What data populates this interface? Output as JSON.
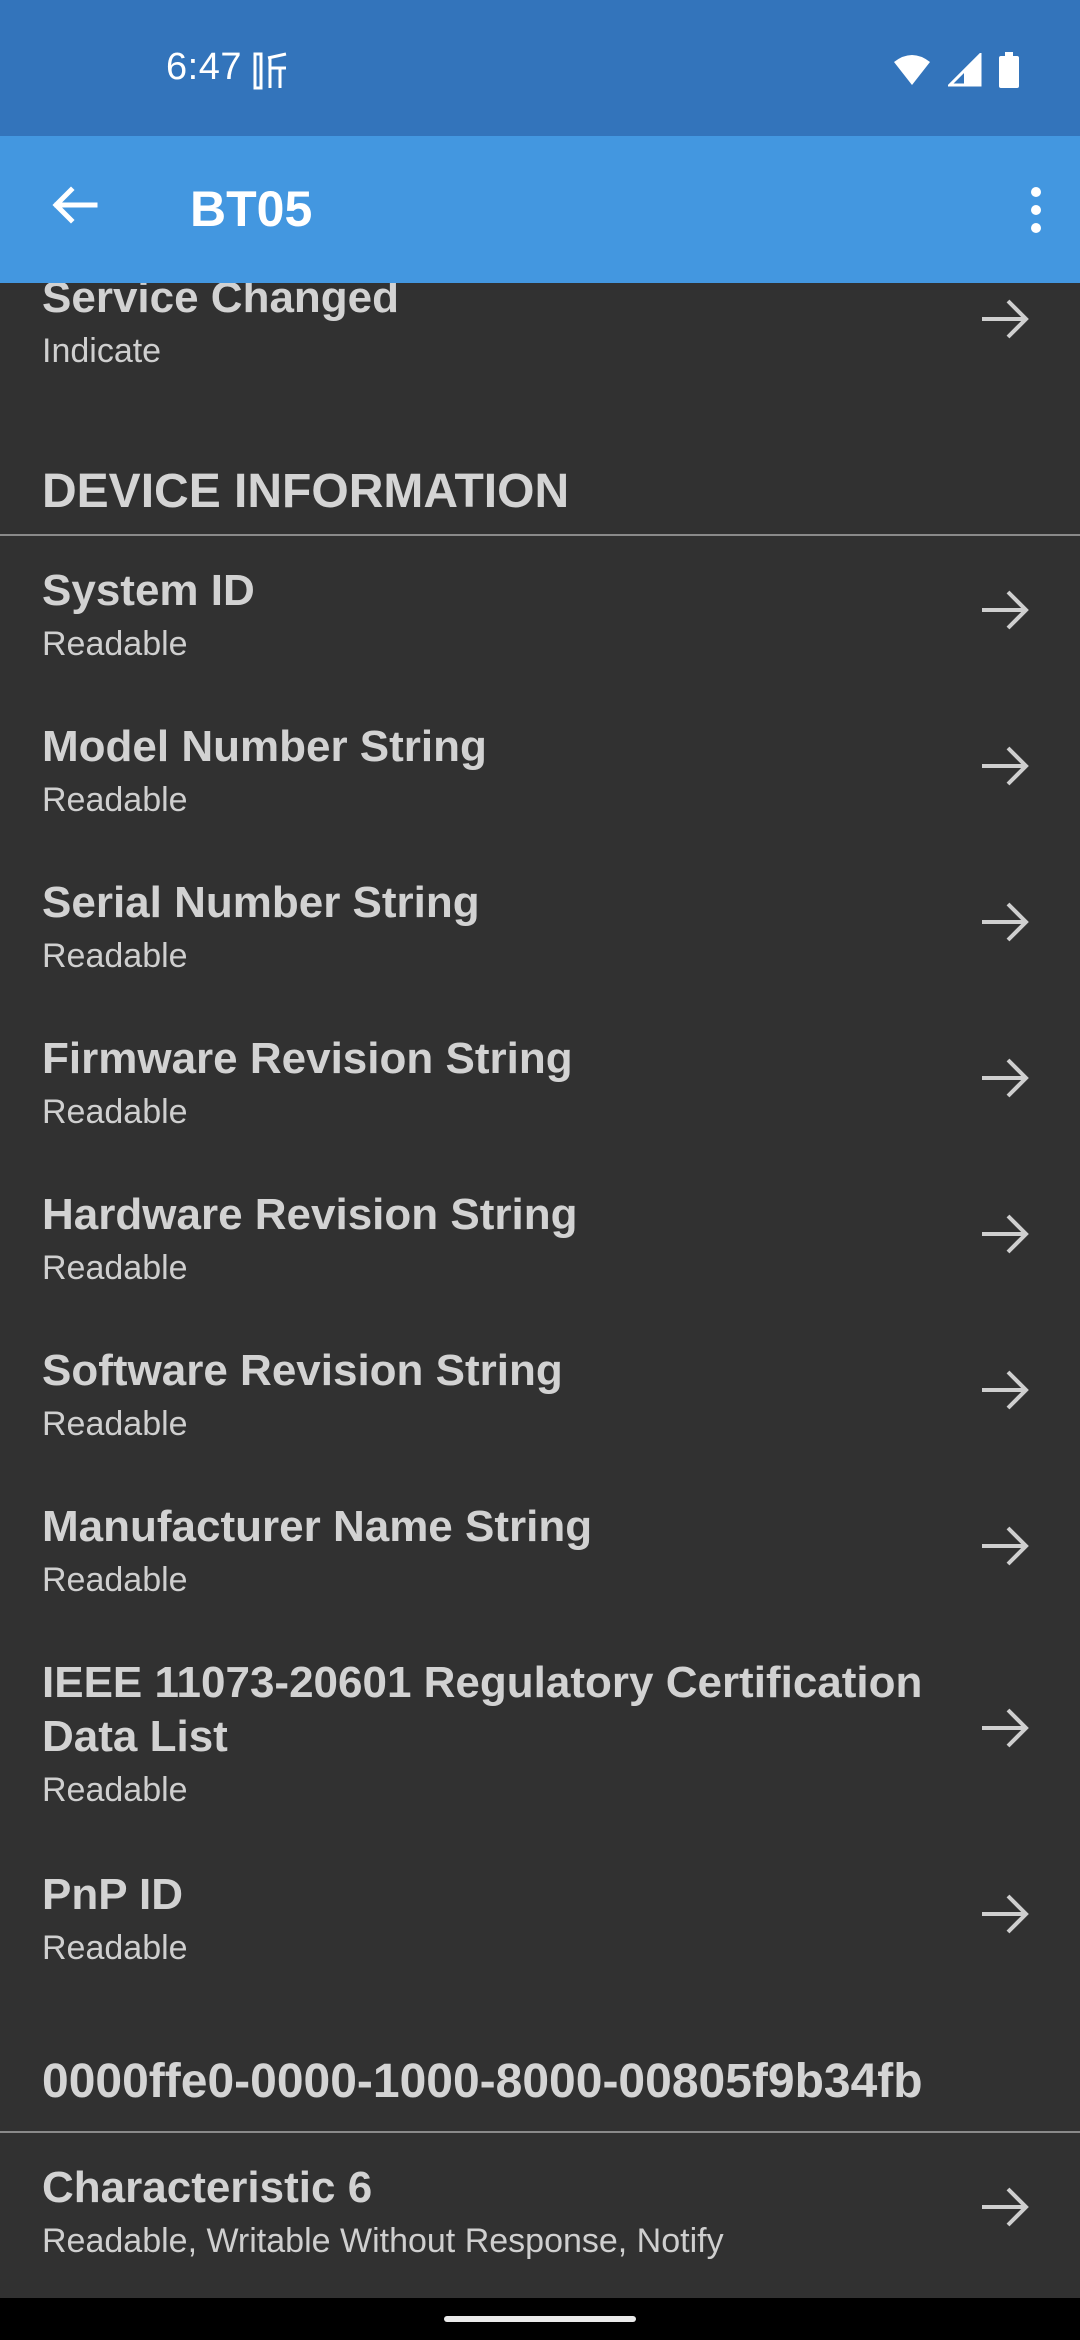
{
  "status_bar": {
    "time": "6:47"
  },
  "app_bar": {
    "title": "BT05"
  },
  "first_item": {
    "title": "Service Changed",
    "sub": "Indicate"
  },
  "section1": {
    "header": "DEVICE INFORMATION",
    "items": [
      {
        "title": "System ID",
        "sub": "Readable"
      },
      {
        "title": "Model Number String",
        "sub": "Readable"
      },
      {
        "title": "Serial Number String",
        "sub": "Readable"
      },
      {
        "title": "Firmware Revision String",
        "sub": "Readable"
      },
      {
        "title": "Hardware Revision String",
        "sub": "Readable"
      },
      {
        "title": "Software Revision String",
        "sub": "Readable"
      },
      {
        "title": "Manufacturer Name String",
        "sub": "Readable"
      },
      {
        "title_line1": "IEEE 11073-20601 Regulatory Certification",
        "title_line2": "Data List",
        "sub": "Readable"
      },
      {
        "title": "PnP ID",
        "sub": "Readable"
      }
    ]
  },
  "section2": {
    "header": "0000ffe0-0000-1000-8000-00805f9b34fb",
    "items": [
      {
        "title": "Characteristic 6",
        "sub": "Readable, Writable Without Response, Notify"
      }
    ]
  },
  "icons": {
    "back": "arrow-left-icon",
    "more": "more-vert-icon",
    "row_arrow": "arrow-right-icon",
    "wifi": "wifi-icon",
    "signal": "signal-icon",
    "battery": "battery-icon"
  },
  "colors": {
    "status_bar": "#3374bb",
    "app_bar": "#4397e0",
    "background": "#313131"
  }
}
